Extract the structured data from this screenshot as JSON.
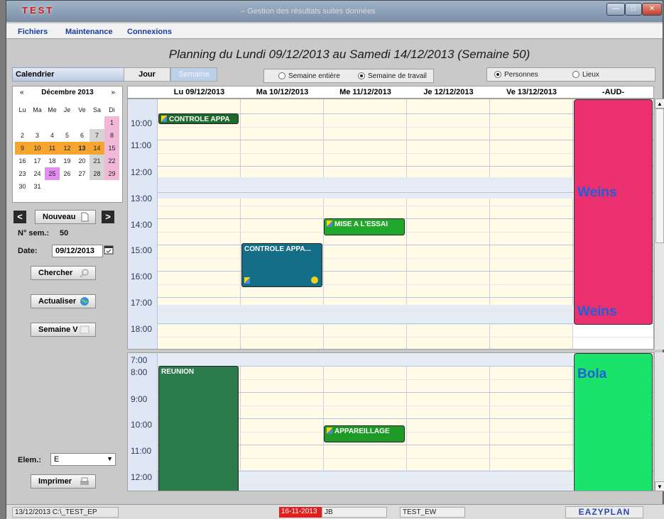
{
  "window": {
    "app_title": "TEST",
    "subtitle": "– Gestion des résultats  suites données",
    "min_glyph": "—",
    "max_glyph": "□",
    "close_glyph": "✕"
  },
  "menu": [
    "Fichiers",
    "Maintenance",
    "Connexions"
  ],
  "planning_title": "Planning du Lundi 09/12/2013 au Samedi 14/12/2013  (Semaine 50)",
  "tabs": {
    "calendar": "Calendrier",
    "jour": "Jour",
    "semaine": "Semaine"
  },
  "week_mode": {
    "option_full": "Semaine entière",
    "option_work": "Semaine de travail",
    "selected": "Semaine de travail"
  },
  "view_mode": {
    "option_people": "Personnes",
    "option_places": "Lieux",
    "selected": "Personnes"
  },
  "mini_calendar": {
    "prev": "«",
    "month": "Décembre 2013",
    "next": "»",
    "weekdays": [
      "Lu",
      "Ma",
      "Me",
      "Je",
      "Ve",
      "Sa",
      "Di"
    ],
    "weeks": [
      [
        "",
        "",
        "",
        "",
        "",
        "",
        "1"
      ],
      [
        "2",
        "3",
        "4",
        "5",
        "6",
        "7",
        "8"
      ],
      [
        "9",
        "10",
        "11",
        "12",
        "13",
        "14",
        "15"
      ],
      [
        "16",
        "17",
        "18",
        "19",
        "20",
        "21",
        "22"
      ],
      [
        "23",
        "24",
        "25",
        "26",
        "27",
        "28",
        "29"
      ],
      [
        "30",
        "31",
        "",
        "",
        "",
        "",
        ""
      ]
    ]
  },
  "controls": {
    "prev_arrow": "<",
    "next_arrow": ">",
    "new_label": "Nouveau",
    "week_no_label": "N° sem.:",
    "week_no_value": "50",
    "date_label": "Date:",
    "date_value": "09/12/2013",
    "search_label": "Chercher",
    "refresh_label": "Actualiser",
    "week_v_label": "Semaine V",
    "elem_label": "Elem.:",
    "elem_value": "E",
    "print_label": "Imprimer"
  },
  "columns": [
    "Lu  09/12/2013",
    "Ma  10/12/2013",
    "Me  11/12/2013",
    "Je  12/12/2013",
    "Ve  13/12/2013",
    "-AUD-"
  ],
  "top_panel": {
    "hours": [
      "10:00",
      "11:00",
      "12:00",
      "13:00",
      "14:00",
      "15:00",
      "16:00",
      "17:00",
      "18:00"
    ],
    "appointments": [
      {
        "label": "CONTROLE APPA",
        "color": "#1f6a2a"
      },
      {
        "label": "MISE A L'ESSAI",
        "color": "#22a82a"
      },
      {
        "label": "CONTROLE APPA...",
        "color": "#146e88"
      }
    ],
    "resource": {
      "name1": "Weins",
      "name2": "Weins",
      "color": "#ec2f6f"
    }
  },
  "bottom_panel": {
    "hours": [
      "7:00",
      "8:00",
      "9:00",
      "10:00",
      "11:00",
      "12:00"
    ],
    "appointments": [
      {
        "label": "REUNION",
        "color": "#2b7c4a"
      },
      {
        "label": "APPAREILLAGE",
        "color": "#1e9a26"
      }
    ],
    "resource": {
      "name": "Bola",
      "color": "#19e36a"
    }
  },
  "statusbar": {
    "date_path": "13/12/2013  C:\\_TEST_EP",
    "alert_date": "16-11-2013",
    "user": "JB",
    "db": "TEST_EW",
    "brand": "EAZYPLAN"
  }
}
